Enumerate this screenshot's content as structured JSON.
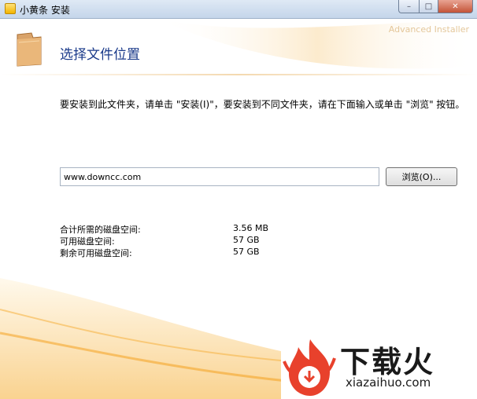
{
  "window": {
    "title": "小黄条 安装",
    "controls": {
      "minimize": "–",
      "maximize": "□",
      "close": "✕"
    }
  },
  "header": {
    "title": "选择文件位置",
    "watermark": "Advanced Installer",
    "icon": "folder-icon"
  },
  "main": {
    "instruction": "要安装到此文件夹，请单击 \"安装(I)\"，要安装到不同文件夹，请在下面输入或单击 \"浏览\" 按钮。",
    "path_value": "www.downcc.com",
    "browse_label": "浏览(O)...",
    "space": [
      {
        "label": "合计所需的磁盘空间:",
        "value": "3.56 MB"
      },
      {
        "label": "可用磁盘空间:",
        "value": "57 GB"
      },
      {
        "label": "剩余可用磁盘空间:",
        "value": "57 GB"
      }
    ]
  },
  "logo": {
    "text": "下载火",
    "domain": "xiazaihuo.com"
  },
  "colors": {
    "title": "#1a3a8a",
    "accent": "#f5a623",
    "logo_red": "#e8412c"
  }
}
